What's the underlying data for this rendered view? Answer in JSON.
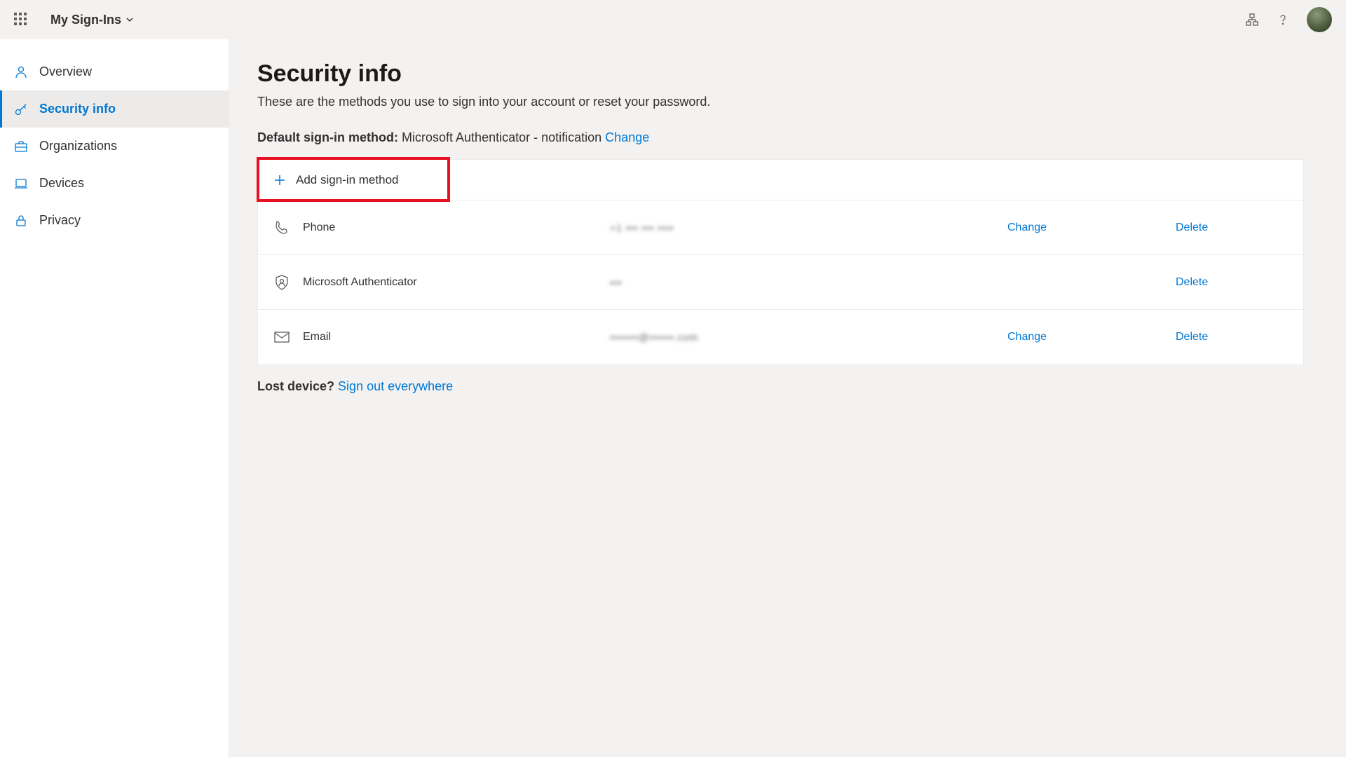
{
  "header": {
    "app_title": "My Sign-Ins"
  },
  "sidebar": {
    "items": [
      {
        "label": "Overview"
      },
      {
        "label": "Security info"
      },
      {
        "label": "Organizations"
      },
      {
        "label": "Devices"
      },
      {
        "label": "Privacy"
      }
    ]
  },
  "main": {
    "title": "Security info",
    "subtitle": "These are the methods you use to sign into your account or reset your password.",
    "default_label": "Default sign-in method:",
    "default_value": "Microsoft Authenticator - notification",
    "change_label": "Change",
    "delete_label": "Delete",
    "add_method_label": "Add sign-in method",
    "methods": [
      {
        "name": "Phone",
        "value": "+1 ••• ••• ••••",
        "has_change": true
      },
      {
        "name": "Microsoft Authenticator",
        "value": "•••",
        "has_change": false
      },
      {
        "name": "Email",
        "value": "•••••••@••••••.com",
        "has_change": true
      }
    ],
    "lost_device_label": "Lost device?",
    "sign_out_label": "Sign out everywhere"
  }
}
